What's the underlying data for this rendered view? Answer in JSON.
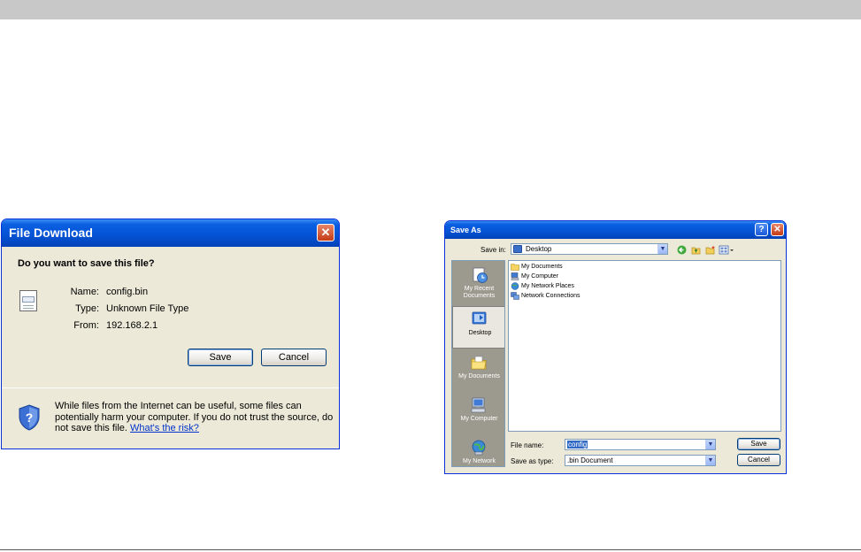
{
  "file_download": {
    "title": "File Download",
    "close": "✕",
    "question": "Do you want to save this file?",
    "name_label": "Name:",
    "name_value": "config.bin",
    "type_label": "Type:",
    "type_value": "Unknown File Type",
    "from_label": "From:",
    "from_value": "192.168.2.1",
    "save_label": "Save",
    "cancel_label": "Cancel",
    "warning_text": "While files from the Internet can be useful, some files can potentially harm your computer. If you do not trust the source, do not save this file.",
    "risk_link": "What's the risk?"
  },
  "save_as": {
    "title": "Save As",
    "help": "?",
    "close": "✕",
    "save_in_label": "Save in:",
    "save_in_value": "Desktop",
    "places": [
      {
        "label_1": "My Recent",
        "label_2": "Documents"
      },
      {
        "label_1": "Desktop",
        "label_2": ""
      },
      {
        "label_1": "My Documents",
        "label_2": ""
      },
      {
        "label_1": "My Computer",
        "label_2": ""
      },
      {
        "label_1": "My Network",
        "label_2": ""
      }
    ],
    "files": [
      "My Documents",
      "My Computer",
      "My Network Places",
      "Network Connections"
    ],
    "file_name_label": "File name:",
    "file_name_value": "config",
    "save_type_label": "Save as type:",
    "save_type_value": ".bin Document",
    "save_label": "Save",
    "cancel_label": "Cancel"
  }
}
